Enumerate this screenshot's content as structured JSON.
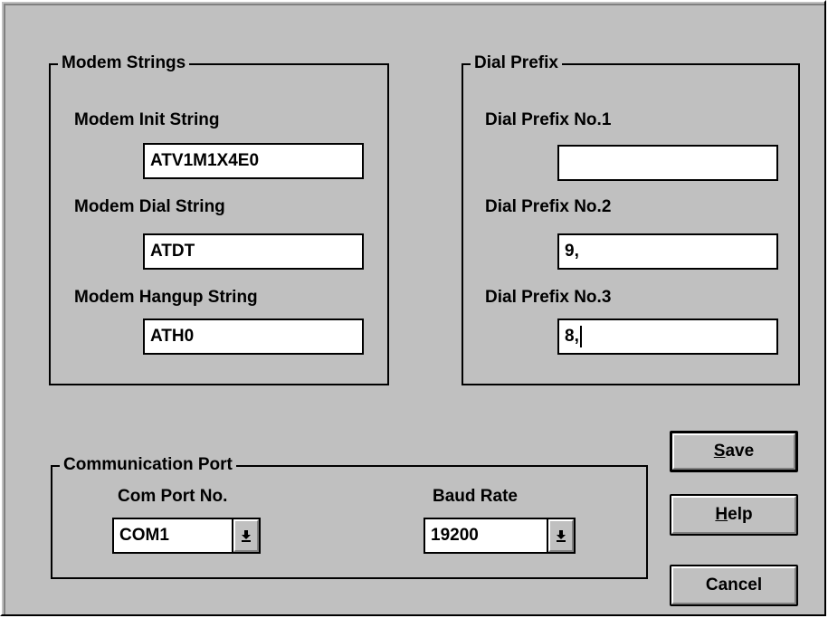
{
  "modem_strings": {
    "title": "Modem Strings",
    "init_label": "Modem Init String",
    "init_value": "ATV1M1X4E0",
    "dial_label": "Modem Dial String",
    "dial_value": "ATDT",
    "hangup_label": "Modem Hangup String",
    "hangup_value": "ATH0"
  },
  "dial_prefix": {
    "title": "Dial Prefix",
    "p1_label": "Dial Prefix No.1",
    "p1_value": "",
    "p2_label": "Dial Prefix No.2",
    "p2_value": "9,",
    "p3_label": "Dial Prefix No.3",
    "p3_value": "8,"
  },
  "comm_port": {
    "title": "Communication Port",
    "port_label": "Com Port No.",
    "port_value": "COM1",
    "baud_label": "Baud Rate",
    "baud_value": "19200"
  },
  "buttons": {
    "save_mnemonic": "S",
    "save_rest": "ave",
    "help_mnemonic": "H",
    "help_rest": "elp",
    "cancel": "Cancel"
  },
  "icons": {
    "dropdown": "dropdown-arrow-icon"
  }
}
